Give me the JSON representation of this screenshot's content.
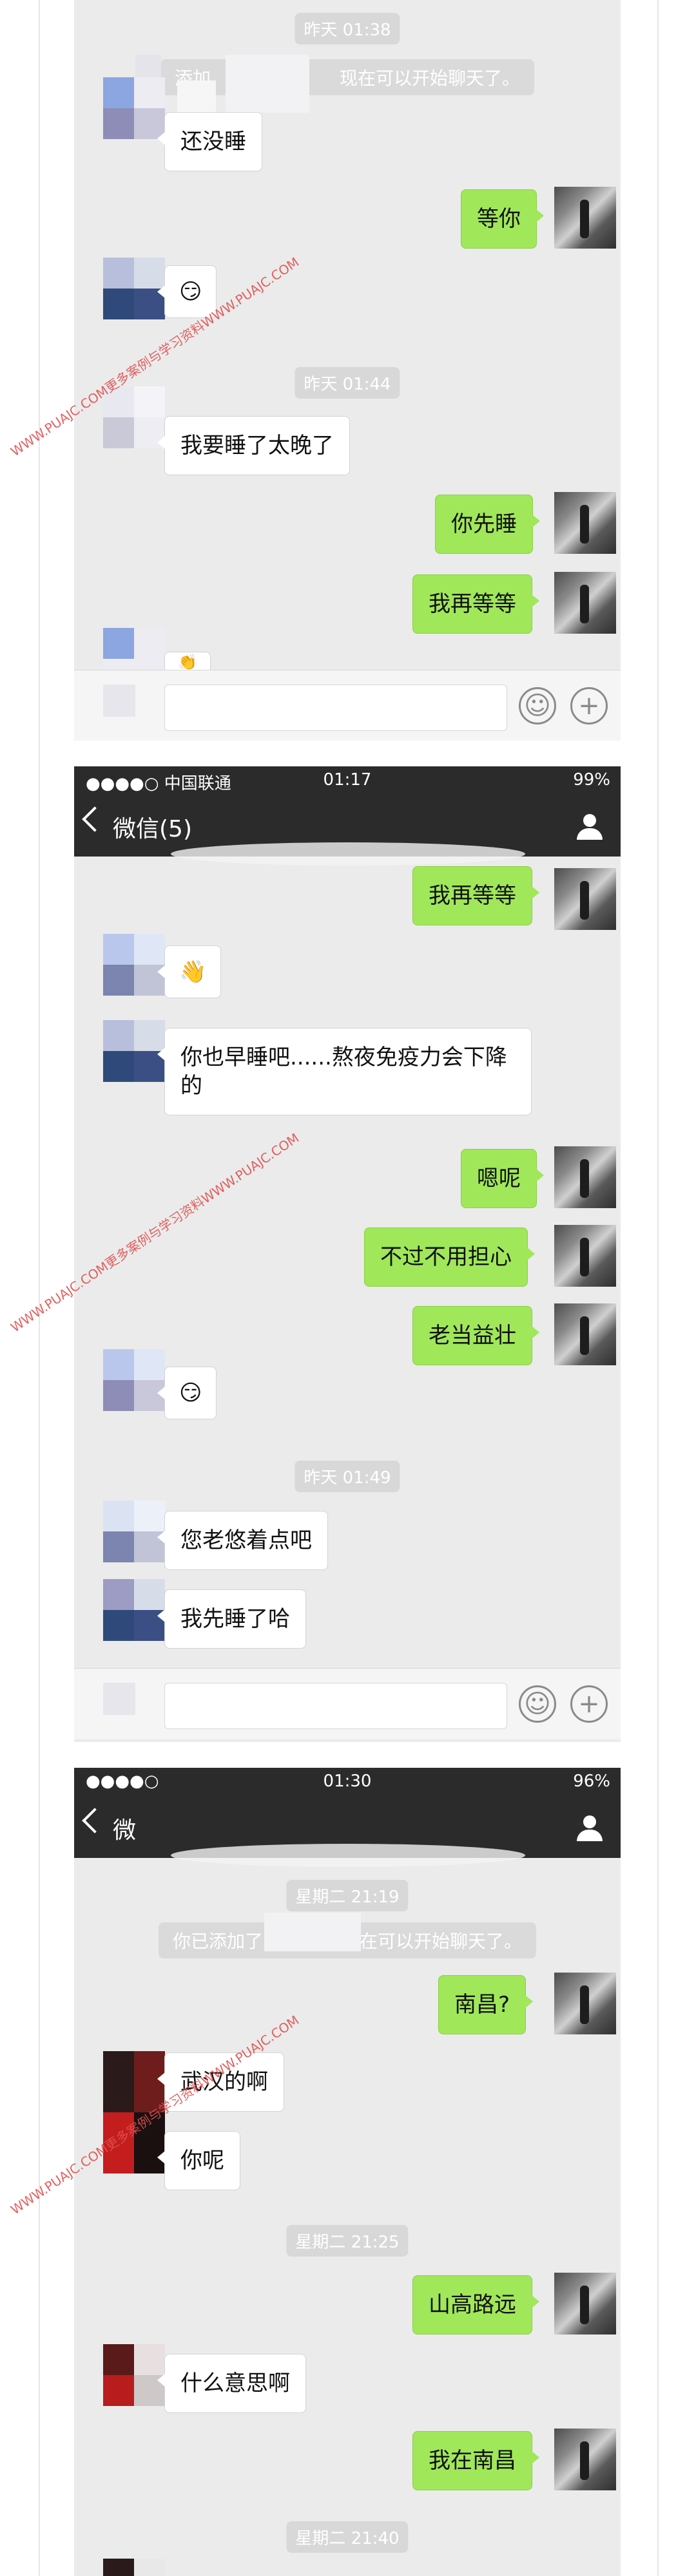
{
  "colors": {
    "outgoing_bubble": "#a0e75a",
    "incoming_bubble": "#ffffff",
    "chat_bg": "#ebebeb",
    "header_bg": "#2b2b2b"
  },
  "watermark": "WWW.PUAJC.COM更多案例与学习资料WWW.PUAJC.COM",
  "panel1": {
    "timestamps": [
      "昨天 01:38",
      "昨天 01:44"
    ],
    "system_msg": "添加",
    "system_msg_tail": "现在可以开始聊天了。",
    "messages": [
      "还没睡",
      "等你",
      "😏",
      "我要睡了太晚了",
      "你先睡",
      "我再等等",
      "👏"
    ],
    "emoji_ok": "😏"
  },
  "panel2": {
    "status": {
      "carrier": "●●●●○ 中国联通",
      "time": "01:17",
      "battery": "99%"
    },
    "title": "微信(5)",
    "timestamps": [
      "昨天 01:49"
    ],
    "messages": [
      "我再等等",
      "👋",
      "你也早睡吧......熬夜免疫力会下降的",
      "嗯呢",
      "不过不用担心",
      "老当益壮",
      "😏",
      "您老悠着点吧",
      "我先睡了哈"
    ]
  },
  "panel3": {
    "status": {
      "carrier": "●●●●○",
      "time": "01:30",
      "battery": "96%"
    },
    "title": "微",
    "timestamps": [
      "星期二 21:19",
      "星期二 21:25",
      "星期二 21:40"
    ],
    "system_msg": "你已添加了",
    "system_msg_tail": "在可以开始聊天了。",
    "messages": [
      "南昌?",
      "武汉的啊",
      "你呢",
      "山高路远",
      "什么意思啊",
      "我在南昌"
    ]
  },
  "icons": [
    "back-icon",
    "user-icon",
    "emoji-icon",
    "plus-icon"
  ]
}
